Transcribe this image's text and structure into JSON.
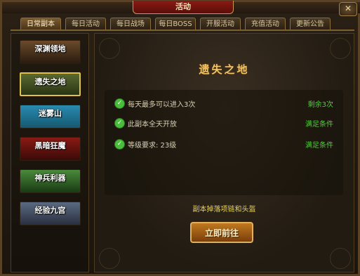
{
  "window": {
    "title": "活动",
    "close_icon": "close-icon"
  },
  "tabs": [
    {
      "label": "日常副本",
      "active": true
    },
    {
      "label": "每日活动",
      "active": false
    },
    {
      "label": "每日战场",
      "active": false
    },
    {
      "label": "每日BOSS",
      "active": false
    },
    {
      "label": "开服活动",
      "active": false
    },
    {
      "label": "充值活动",
      "active": false
    },
    {
      "label": "更新公告",
      "active": false
    }
  ],
  "dungeons": [
    {
      "label": "深渊领地",
      "selected": false,
      "color": "#6a4a2a"
    },
    {
      "label": "遗失之地",
      "selected": true,
      "color": "#5a6a30"
    },
    {
      "label": "迷雾山",
      "selected": false,
      "color": "#2a8ab0"
    },
    {
      "label": "黑暗狂魔",
      "selected": false,
      "color": "#8a1a14"
    },
    {
      "label": "神兵利器",
      "selected": false,
      "color": "#4a8a3a"
    },
    {
      "label": "经验九宫",
      "selected": false,
      "color": "#5a6a80"
    }
  ],
  "detail": {
    "title": "遗失之地",
    "conditions": [
      {
        "text": "每天最多可以进入3次",
        "status": "剩余3次"
      },
      {
        "text": "此副本全天开放",
        "status": "满足条件"
      },
      {
        "text": "等级要求: 23级",
        "status": "满足条件"
      }
    ],
    "drop_text": "副本掉落项链和头盔",
    "go_button": "立即前往"
  }
}
